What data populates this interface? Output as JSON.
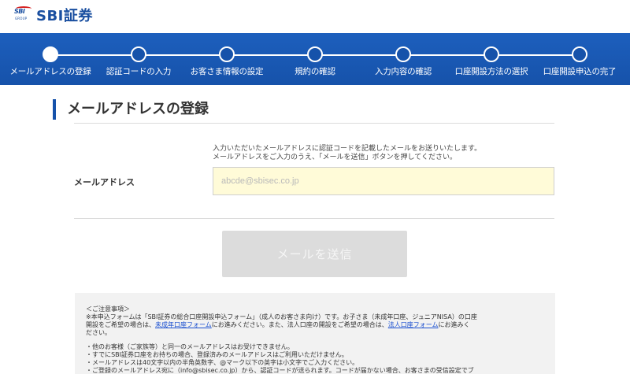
{
  "brand": {
    "logo_small": "SBI",
    "logo_group": "GROUP",
    "name": "SBI証券"
  },
  "steps": [
    {
      "label": "メールアドレスの登録",
      "active": true
    },
    {
      "label": "認証コードの入力",
      "active": false
    },
    {
      "label": "お客さま情報の設定",
      "active": false
    },
    {
      "label": "規約の確認",
      "active": false
    },
    {
      "label": "入力内容の確認",
      "active": false
    },
    {
      "label": "口座開設方法の選択",
      "active": false
    },
    {
      "label": "口座開設申込の完了",
      "active": false
    }
  ],
  "main": {
    "title": "メールアドレスの登録",
    "instruction_1": "入力いただいたメールアドレスに認証コードを記載したメールをお送りいたします。",
    "instruction_2": "メールアドレスをご入力のうえ、「メールを送信」ボタンを押してください。",
    "email_label": "メールアドレス",
    "email_placeholder": "abcde@sbisec.co.jp",
    "email_value": "",
    "send_button": "メールを送信"
  },
  "notes": {
    "heading": "＜ご注意事項＞",
    "p1_a": "※本申込フォームは「SBI証券の総合口座開設申込フォーム」（成人のお客さま向け）です。お子さま（未成年口座、ジュニアNISA）の口座",
    "p1_b": "開設をご希望の場合は、",
    "link_minor": "未成年口座フォーム",
    "p1_c": "にお進みください。また、法人口座の開設をご希望の場合は、",
    "link_corp": "法人口座フォーム",
    "p1_d": "にお進みく",
    "p1_e": "ださい。",
    "b1": "・他のお客様（ご家族等）と同一のメールアドレスはお受けできません。",
    "b2": "・すでにSBI証券口座をお持ちの場合、登録済みのメールアドレスはご利用いただけません。",
    "b3": "・メールアドレスは40文字以内の半角英数字、@マーク以下の英字は小文字でご入力ください。",
    "b4": "・ご登録のメールアドレス宛に（info@sbisec.co.jp）から、認証コードが送られます。コードが届かない場合、お客さまの受信設定でブ"
  },
  "colors": {
    "brand_blue": "#1652aa",
    "input_bg": "#fffbd8",
    "button_disabled": "#dcdcdc",
    "notes_bg": "#f2f2f2",
    "link": "#1a4fd0"
  },
  "icons": {
    "step_active": "filled-circle",
    "step_inactive": "hollow-circle"
  }
}
